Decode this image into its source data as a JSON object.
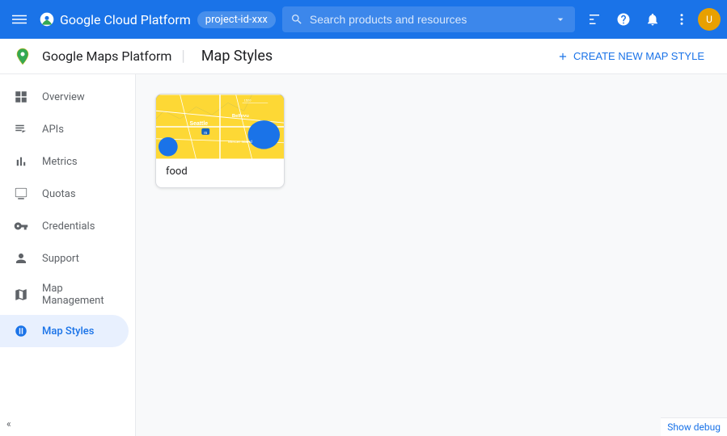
{
  "header": {
    "menu_icon": "☰",
    "brand": "Google Cloud Platform",
    "account": "project-id-xxx",
    "search_placeholder": "Search products and resources",
    "search_dropdown_icon": "▾"
  },
  "sub_header": {
    "app_name": "Google Maps Platform",
    "page_title": "Map Styles",
    "create_button": "CREATE NEW MAP STYLE"
  },
  "sidebar": {
    "items": [
      {
        "id": "overview",
        "label": "Overview",
        "icon": "grid"
      },
      {
        "id": "apis",
        "label": "APIs",
        "icon": "list"
      },
      {
        "id": "metrics",
        "label": "Metrics",
        "icon": "bar_chart"
      },
      {
        "id": "quotas",
        "label": "Quotas",
        "icon": "monitor"
      },
      {
        "id": "credentials",
        "label": "Credentials",
        "icon": "key"
      },
      {
        "id": "support",
        "label": "Support",
        "icon": "person"
      },
      {
        "id": "map_management",
        "label": "Map Management",
        "icon": "layers"
      },
      {
        "id": "map_styles",
        "label": "Map Styles",
        "icon": "style",
        "active": true
      }
    ],
    "collapse_label": "«"
  },
  "main": {
    "style_cards": [
      {
        "name": "food",
        "preview": "seattle_map"
      }
    ]
  },
  "debug_bar": {
    "label": "Show debug"
  }
}
